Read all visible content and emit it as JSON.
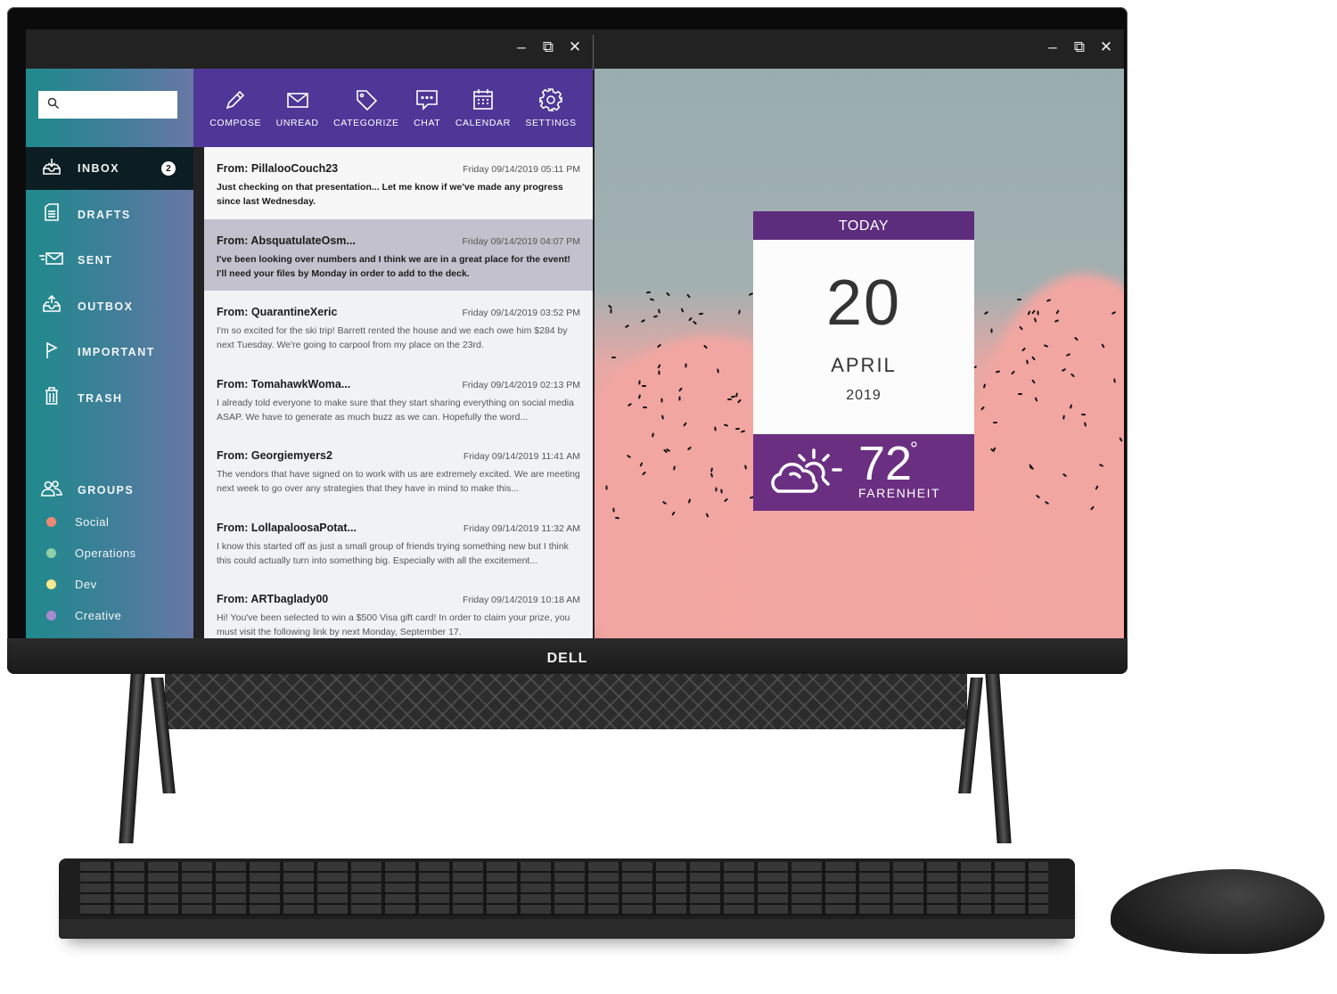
{
  "brand": "DELL",
  "window_controls": {
    "minimize": "–",
    "restore": "⧉",
    "close": "✕"
  },
  "mail": {
    "search": {
      "placeholder": "",
      "value": ""
    },
    "nav": [
      {
        "label": "INBOX",
        "icon": "inbox-download-icon",
        "badge": "2",
        "active": true
      },
      {
        "label": "DRAFTS",
        "icon": "document-icon"
      },
      {
        "label": "SENT",
        "icon": "send-mail-icon"
      },
      {
        "label": "OUTBOX",
        "icon": "inbox-upload-icon"
      },
      {
        "label": "IMPORTANT",
        "icon": "flag-icon"
      },
      {
        "label": "TRASH",
        "icon": "trash-icon"
      }
    ],
    "groups": {
      "label": "GROUPS",
      "items": [
        {
          "label": "Social",
          "color": "#f08a72"
        },
        {
          "label": "Operations",
          "color": "#8fd0a8"
        },
        {
          "label": "Dev",
          "color": "#f4ea8e"
        },
        {
          "label": "Creative",
          "color": "#a98bd0"
        }
      ]
    },
    "toolbar": [
      {
        "label": "COMPOSE",
        "icon": "pencil-icon"
      },
      {
        "label": "UNREAD",
        "icon": "envelope-icon"
      },
      {
        "label": "CATEGORIZE",
        "icon": "tag-icon"
      },
      {
        "label": "CHAT",
        "icon": "chat-icon"
      },
      {
        "label": "CALENDAR",
        "icon": "calendar-icon"
      },
      {
        "label": "SETTINGS",
        "icon": "gear-icon"
      }
    ],
    "messages": [
      {
        "from": "From: PillalooCouch23",
        "date": "Friday 09/14/2019 05:11 PM",
        "body": "Just checking on that presentation... Let me know if we've made any progress since last Wednesday."
      },
      {
        "from": "From: AbsquatulateOsm...",
        "date": "Friday 09/14/2019 04:07 PM",
        "body": "I've been looking over numbers and I think we are in a great place for the event! I'll need your files by Monday in order to add to the deck."
      },
      {
        "from": "From: QuarantineXeric",
        "date": "Friday 09/14/2019 03:52 PM",
        "body": "I'm so excited for the ski trip! Barrett rented the house and we each owe him $284 by next Tuesday. We're going to carpool from my place on the 23rd."
      },
      {
        "from": "From: TomahawkWoma...",
        "date": "Friday 09/14/2019 02:13 PM",
        "body": "I already told everyone to make sure that they start sharing everything on social media ASAP. We have to generate as much buzz as we can. Hopefully the word..."
      },
      {
        "from": "From: Georgiemyers2",
        "date": "Friday 09/14/2019 11:41 AM",
        "body": "The vendors that have signed on to work with us are extremely excited. We are meeting next week to go over any strategies that they have in mind to make this..."
      },
      {
        "from": "From: LollapaloosaPotat...",
        "date": "Friday 09/14/2019 11:32 AM",
        "body": "I know this started off as just a small group of friends trying something new but I think this could actually turn into something big. Especially with all the excitement..."
      },
      {
        "from": "From: ARTbaglady00",
        "date": "Friday 09/14/2019 10:18 AM",
        "body": "Hi! You've been selected to win a $500 Visa gift card! In order to claim your prize, you must visit the following link by next Monday, September 17."
      }
    ]
  },
  "widget": {
    "header": "TODAY",
    "day": "20",
    "month": "APRIL",
    "year": "2019",
    "temperature": "72",
    "degree": "°",
    "unit": "FARENHEIT",
    "weather_icon": "partly-cloudy-icon"
  },
  "colors": {
    "toolbar": "#4e3797",
    "widget_purple": "#6b2f82",
    "sidebar_start": "#1f8a8c",
    "sidebar_end": "#6878a4"
  }
}
